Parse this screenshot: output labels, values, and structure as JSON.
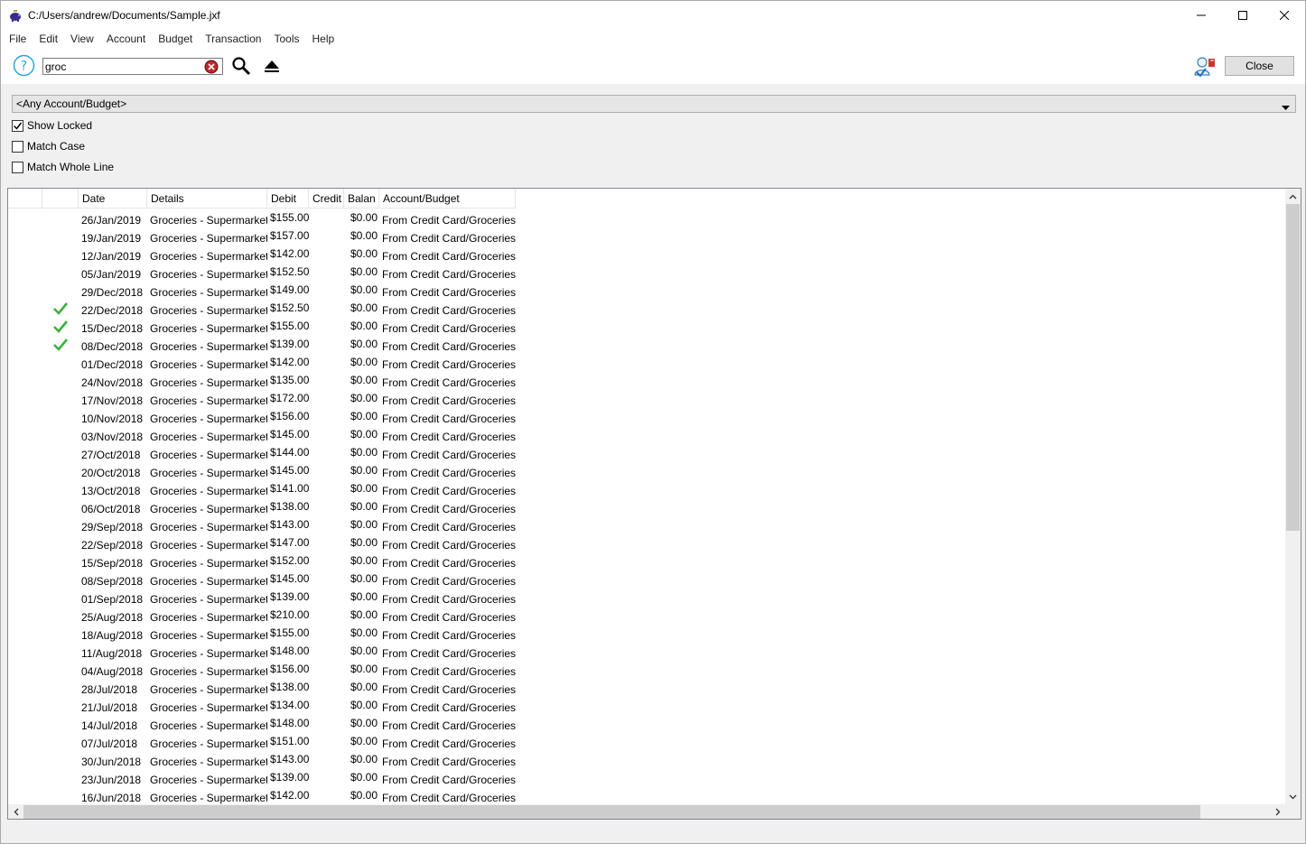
{
  "window": {
    "title": "C:/Users/andrew/Documents/Sample.jxf",
    "controls": {
      "minimize": "minimize-icon",
      "maximize": "maximize-icon",
      "close": "close-icon"
    }
  },
  "menu": [
    "File",
    "Edit",
    "View",
    "Account",
    "Budget",
    "Transaction",
    "Tools",
    "Help"
  ],
  "toolbar": {
    "search_value": "groc",
    "close_label": "Close"
  },
  "filters": {
    "account_selected": "<Any Account/Budget>",
    "show_locked": {
      "label": "Show Locked",
      "checked": true
    },
    "match_case": {
      "label": "Match Case",
      "checked": false
    },
    "match_whole_line": {
      "label": "Match Whole Line",
      "checked": false
    }
  },
  "table": {
    "columns": [
      "",
      "",
      "Date",
      "Details",
      "Debit",
      "Credit",
      "Balan",
      "Account/Budget"
    ],
    "rows": [
      {
        "reconciled": false,
        "date": "26/Jan/2019",
        "details": "Groceries - Supermarket",
        "debit": "$155.00",
        "credit": "",
        "balance": "$0.00",
        "account": "From Credit Card/Groceries"
      },
      {
        "reconciled": false,
        "date": "19/Jan/2019",
        "details": "Groceries - Supermarket",
        "debit": "$157.00",
        "credit": "",
        "balance": "$0.00",
        "account": "From Credit Card/Groceries"
      },
      {
        "reconciled": false,
        "date": "12/Jan/2019",
        "details": "Groceries - Supermarket",
        "debit": "$142.00",
        "credit": "",
        "balance": "$0.00",
        "account": "From Credit Card/Groceries"
      },
      {
        "reconciled": false,
        "date": "05/Jan/2019",
        "details": "Groceries - Supermarket",
        "debit": "$152.50",
        "credit": "",
        "balance": "$0.00",
        "account": "From Credit Card/Groceries"
      },
      {
        "reconciled": false,
        "date": "29/Dec/2018",
        "details": "Groceries - Supermarket",
        "debit": "$149.00",
        "credit": "",
        "balance": "$0.00",
        "account": "From Credit Card/Groceries"
      },
      {
        "reconciled": true,
        "date": "22/Dec/2018",
        "details": "Groceries - Supermarket",
        "debit": "$152.50",
        "credit": "",
        "balance": "$0.00",
        "account": "From Credit Card/Groceries"
      },
      {
        "reconciled": true,
        "date": "15/Dec/2018",
        "details": "Groceries - Supermarket",
        "debit": "$155.00",
        "credit": "",
        "balance": "$0.00",
        "account": "From Credit Card/Groceries"
      },
      {
        "reconciled": true,
        "date": "08/Dec/2018",
        "details": "Groceries - Supermarket",
        "debit": "$139.00",
        "credit": "",
        "balance": "$0.00",
        "account": "From Credit Card/Groceries"
      },
      {
        "reconciled": false,
        "date": "01/Dec/2018",
        "details": "Groceries - Supermarket",
        "debit": "$142.00",
        "credit": "",
        "balance": "$0.00",
        "account": "From Credit Card/Groceries"
      },
      {
        "reconciled": false,
        "date": "24/Nov/2018",
        "details": "Groceries - Supermarket",
        "debit": "$135.00",
        "credit": "",
        "balance": "$0.00",
        "account": "From Credit Card/Groceries"
      },
      {
        "reconciled": false,
        "date": "17/Nov/2018",
        "details": "Groceries - Supermarket",
        "debit": "$172.00",
        "credit": "",
        "balance": "$0.00",
        "account": "From Credit Card/Groceries"
      },
      {
        "reconciled": false,
        "date": "10/Nov/2018",
        "details": "Groceries - Supermarket",
        "debit": "$156.00",
        "credit": "",
        "balance": "$0.00",
        "account": "From Credit Card/Groceries"
      },
      {
        "reconciled": false,
        "date": "03/Nov/2018",
        "details": "Groceries - Supermarket",
        "debit": "$145.00",
        "credit": "",
        "balance": "$0.00",
        "account": "From Credit Card/Groceries"
      },
      {
        "reconciled": false,
        "date": "27/Oct/2018",
        "details": "Groceries - Supermarket",
        "debit": "$144.00",
        "credit": "",
        "balance": "$0.00",
        "account": "From Credit Card/Groceries"
      },
      {
        "reconciled": false,
        "date": "20/Oct/2018",
        "details": "Groceries - Supermarket",
        "debit": "$145.00",
        "credit": "",
        "balance": "$0.00",
        "account": "From Credit Card/Groceries"
      },
      {
        "reconciled": false,
        "date": "13/Oct/2018",
        "details": "Groceries - Supermarket",
        "debit": "$141.00",
        "credit": "",
        "balance": "$0.00",
        "account": "From Credit Card/Groceries"
      },
      {
        "reconciled": false,
        "date": "06/Oct/2018",
        "details": "Groceries - Supermarket",
        "debit": "$138.00",
        "credit": "",
        "balance": "$0.00",
        "account": "From Credit Card/Groceries"
      },
      {
        "reconciled": false,
        "date": "29/Sep/2018",
        "details": "Groceries - Supermarket",
        "debit": "$143.00",
        "credit": "",
        "balance": "$0.00",
        "account": "From Credit Card/Groceries"
      },
      {
        "reconciled": false,
        "date": "22/Sep/2018",
        "details": "Groceries - Supermarket",
        "debit": "$147.00",
        "credit": "",
        "balance": "$0.00",
        "account": "From Credit Card/Groceries"
      },
      {
        "reconciled": false,
        "date": "15/Sep/2018",
        "details": "Groceries - Supermarket",
        "debit": "$152.00",
        "credit": "",
        "balance": "$0.00",
        "account": "From Credit Card/Groceries"
      },
      {
        "reconciled": false,
        "date": "08/Sep/2018",
        "details": "Groceries - Supermarket",
        "debit": "$145.00",
        "credit": "",
        "balance": "$0.00",
        "account": "From Credit Card/Groceries"
      },
      {
        "reconciled": false,
        "date": "01/Sep/2018",
        "details": "Groceries - Supermarket",
        "debit": "$139.00",
        "credit": "",
        "balance": "$0.00",
        "account": "From Credit Card/Groceries"
      },
      {
        "reconciled": false,
        "date": "25/Aug/2018",
        "details": "Groceries - Supermarket",
        "debit": "$210.00",
        "credit": "",
        "balance": "$0.00",
        "account": "From Credit Card/Groceries"
      },
      {
        "reconciled": false,
        "date": "18/Aug/2018",
        "details": "Groceries - Supermarket",
        "debit": "$155.00",
        "credit": "",
        "balance": "$0.00",
        "account": "From Credit Card/Groceries"
      },
      {
        "reconciled": false,
        "date": "11/Aug/2018",
        "details": "Groceries - Supermarket",
        "debit": "$148.00",
        "credit": "",
        "balance": "$0.00",
        "account": "From Credit Card/Groceries"
      },
      {
        "reconciled": false,
        "date": "04/Aug/2018",
        "details": "Groceries - Supermarket",
        "debit": "$156.00",
        "credit": "",
        "balance": "$0.00",
        "account": "From Credit Card/Groceries"
      },
      {
        "reconciled": false,
        "date": "28/Jul/2018",
        "details": "Groceries - Supermarket",
        "debit": "$138.00",
        "credit": "",
        "balance": "$0.00",
        "account": "From Credit Card/Groceries"
      },
      {
        "reconciled": false,
        "date": "21/Jul/2018",
        "details": "Groceries - Supermarket",
        "debit": "$134.00",
        "credit": "",
        "balance": "$0.00",
        "account": "From Credit Card/Groceries"
      },
      {
        "reconciled": false,
        "date": "14/Jul/2018",
        "details": "Groceries - Supermarket",
        "debit": "$148.00",
        "credit": "",
        "balance": "$0.00",
        "account": "From Credit Card/Groceries"
      },
      {
        "reconciled": false,
        "date": "07/Jul/2018",
        "details": "Groceries - Supermarket",
        "debit": "$151.00",
        "credit": "",
        "balance": "$0.00",
        "account": "From Credit Card/Groceries"
      },
      {
        "reconciled": false,
        "date": "30/Jun/2018",
        "details": "Groceries - Supermarket",
        "debit": "$143.00",
        "credit": "",
        "balance": "$0.00",
        "account": "From Credit Card/Groceries"
      },
      {
        "reconciled": false,
        "date": "23/Jun/2018",
        "details": "Groceries - Supermarket",
        "debit": "$139.00",
        "credit": "",
        "balance": "$0.00",
        "account": "From Credit Card/Groceries"
      },
      {
        "reconciled": false,
        "date": "16/Jun/2018",
        "details": "Groceries - Supermarket",
        "debit": "$142.00",
        "credit": "",
        "balance": "$0.00",
        "account": "From Credit Card/Groceries"
      }
    ]
  },
  "colors": {
    "check_green": "#3fae3f",
    "help_blue": "#2aa5d8",
    "clear_red": "#c0272d"
  }
}
